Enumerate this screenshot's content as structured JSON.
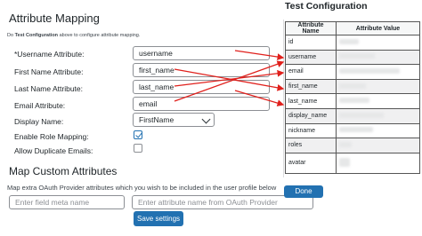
{
  "attribute_mapping": {
    "title": "Attribute Mapping",
    "hint_prefix": "Do ",
    "hint_bold": "Test Configuration",
    "hint_suffix": " above to configure attribute mapping.",
    "fields": [
      {
        "label": "*Username Attribute:",
        "value": "username"
      },
      {
        "label": "First Name Attribute:",
        "value": "first_name"
      },
      {
        "label": "Last Name Attribute:",
        "value": "last_name"
      },
      {
        "label": "Email Attribute:",
        "value": "email"
      }
    ],
    "display_name": {
      "label": "Display Name:",
      "value": "FirstName"
    },
    "enable_role_mapping": {
      "label": "Enable Role Mapping:",
      "checked": true
    },
    "allow_duplicate_emails": {
      "label": "Allow Duplicate Emails:",
      "checked": false
    }
  },
  "custom_attributes": {
    "title": "Map Custom Attributes",
    "hint": "Map extra OAuth Provider attributes which you wish to be included in the user profile below",
    "meta_placeholder": "Enter field meta name",
    "attr_placeholder": "Enter attribute name from OAuth Provider",
    "save_label": "Save settings"
  },
  "test_configuration": {
    "title": "Test Configuration",
    "col_name": "Attribute Name",
    "col_value": "Attribute Value",
    "rows": [
      {
        "name": "id"
      },
      {
        "name": "username"
      },
      {
        "name": "email"
      },
      {
        "name": "first_name"
      },
      {
        "name": "last_name"
      },
      {
        "name": "display_name"
      },
      {
        "name": "nickname"
      },
      {
        "name": "roles"
      },
      {
        "name": "avatar"
      }
    ],
    "done_label": "Done"
  },
  "colors": {
    "accent": "#2271b1",
    "arrow": "#e0201c"
  }
}
